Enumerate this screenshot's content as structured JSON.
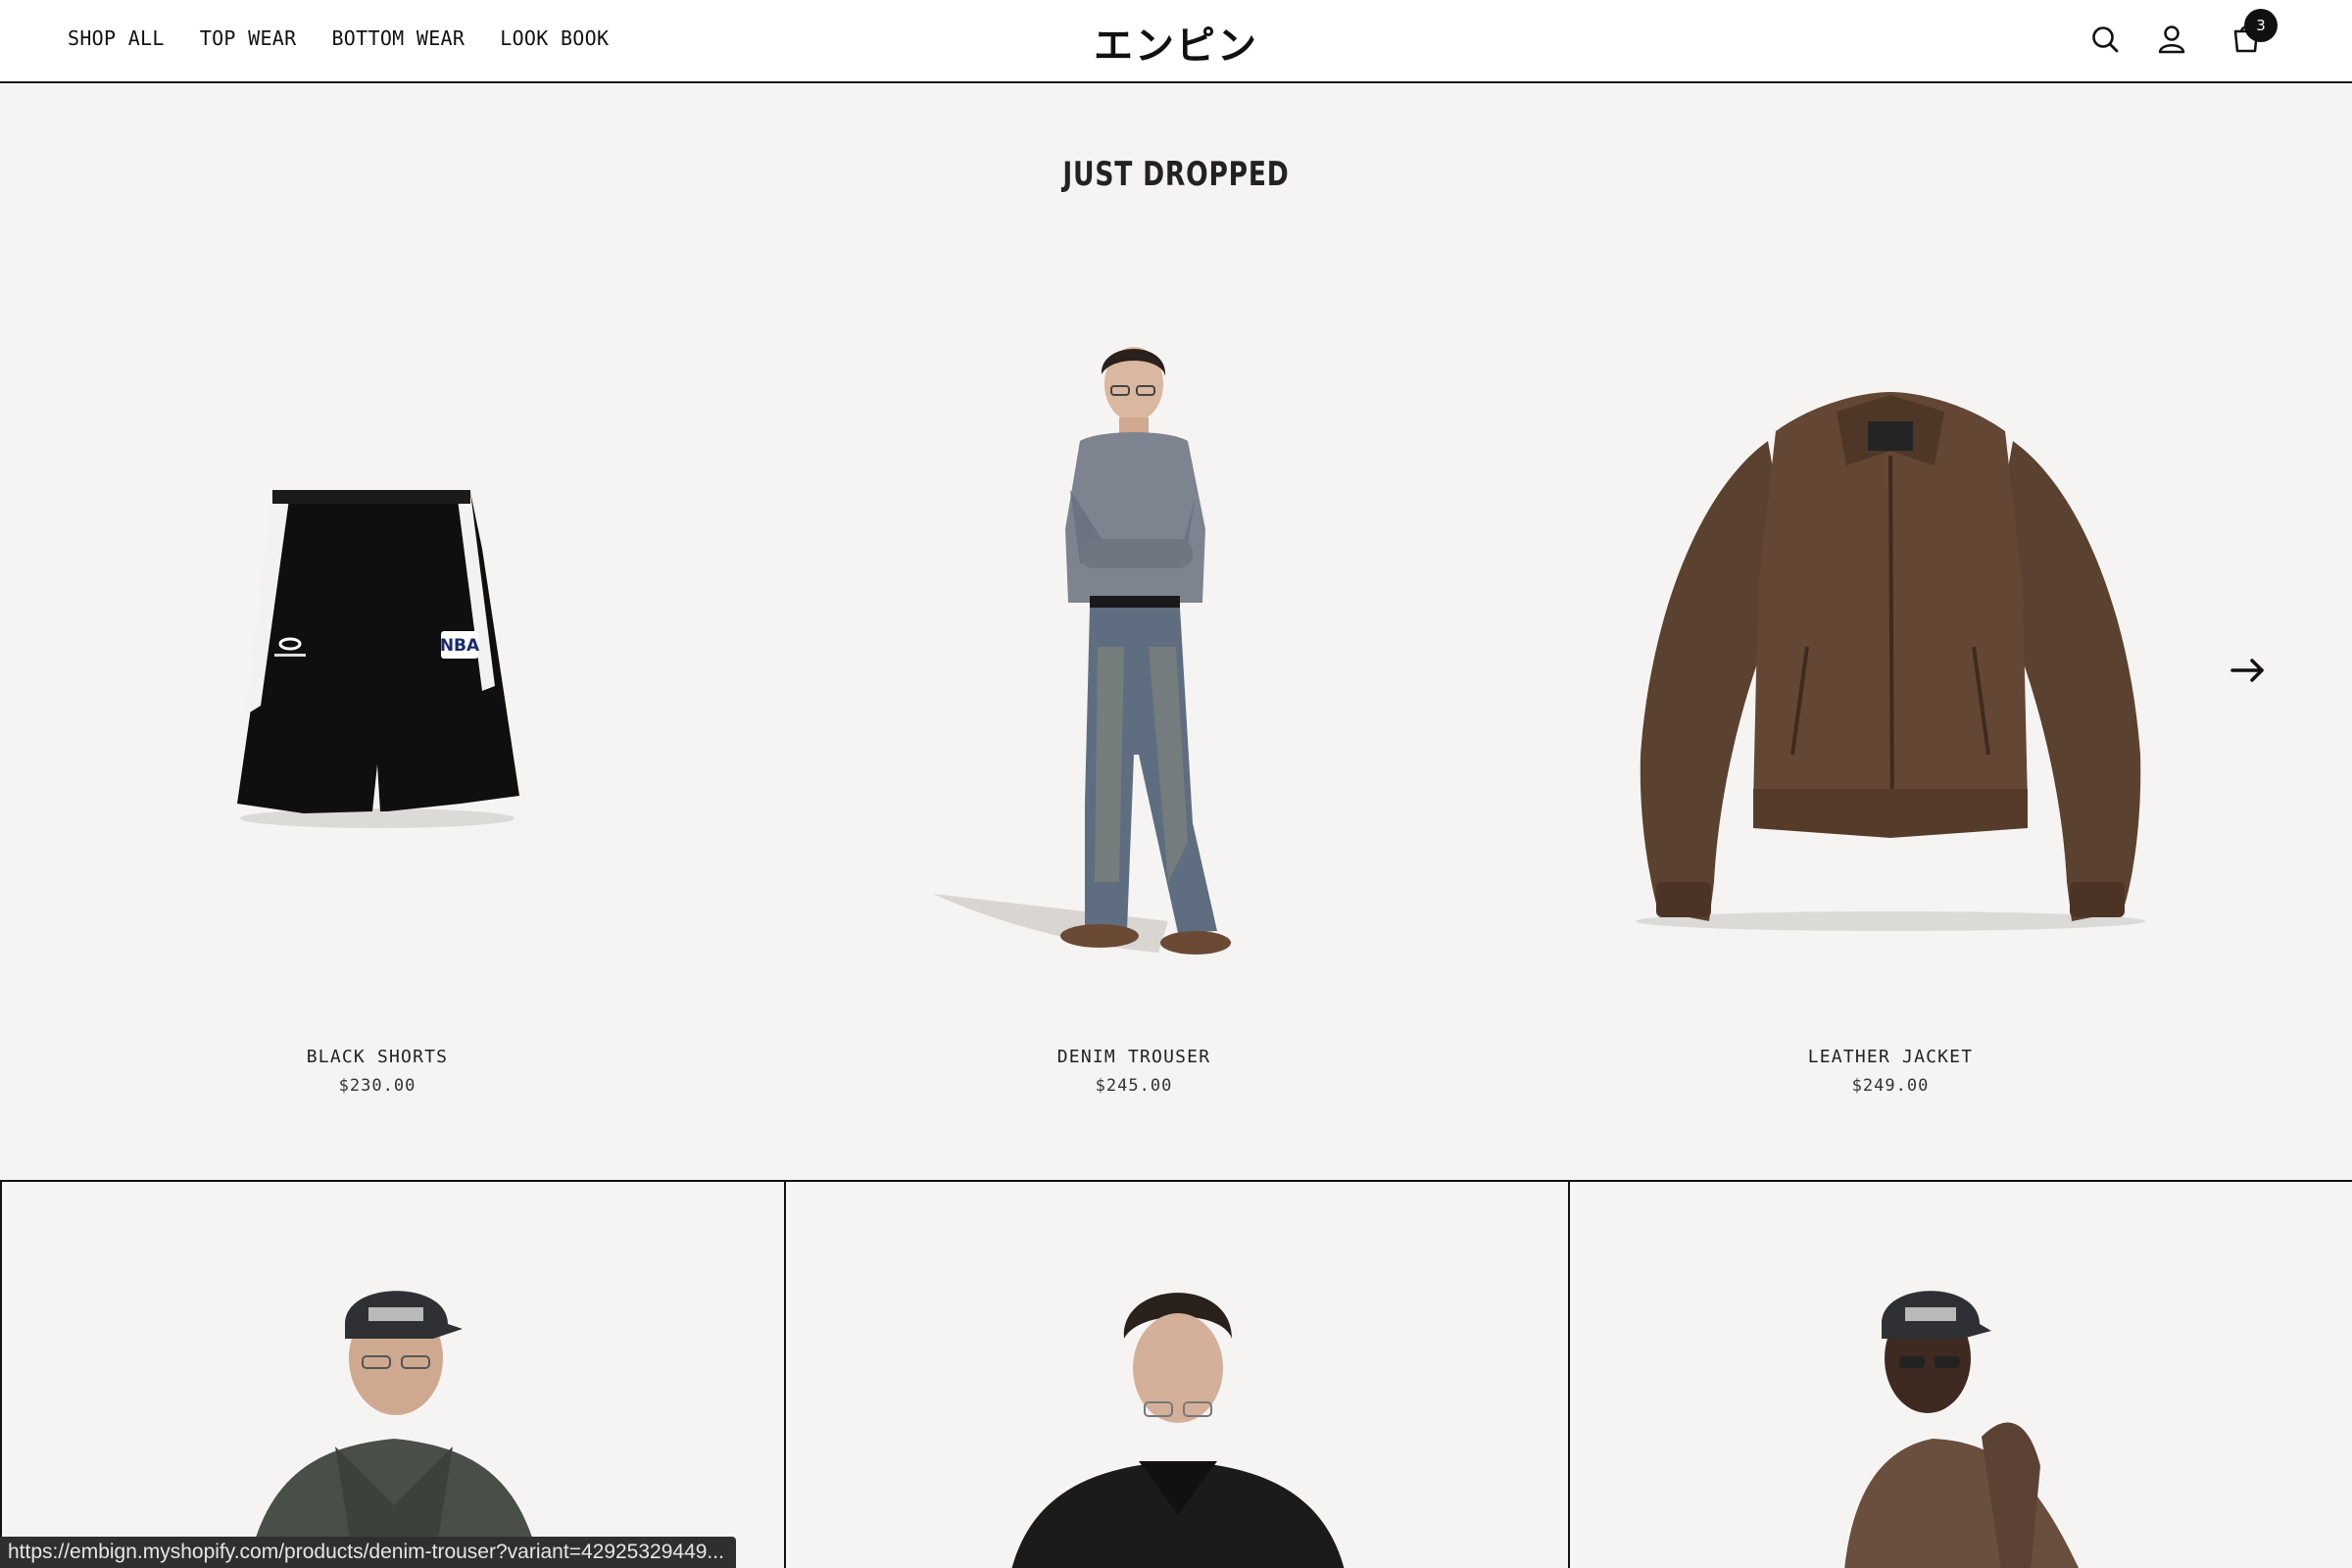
{
  "header": {
    "nav": [
      "SHOP ALL",
      "TOP WEAR",
      "BOTTOM WEAR",
      "LOOK BOOK"
    ],
    "logo": "エンピン",
    "cart_count": "3",
    "icons": [
      "search-icon",
      "account-icon",
      "cart-icon"
    ]
  },
  "section": {
    "title": "JUST DROPPED"
  },
  "products": [
    {
      "name": "BLACK SHORTS",
      "price": "$230.00"
    },
    {
      "name": "DENIM TROUSER",
      "price": "$245.00"
    },
    {
      "name": "LEATHER JACKET",
      "price": "$249.00"
    }
  ],
  "carousel": {
    "next_icon": "arrow-right-icon"
  },
  "status_bar": {
    "url": "https://embign.myshopify.com/products/denim-trouser?variant=42925329449..."
  },
  "colors": {
    "background": "#f5f4f2",
    "header": "#ffffff",
    "text": "#111111"
  }
}
